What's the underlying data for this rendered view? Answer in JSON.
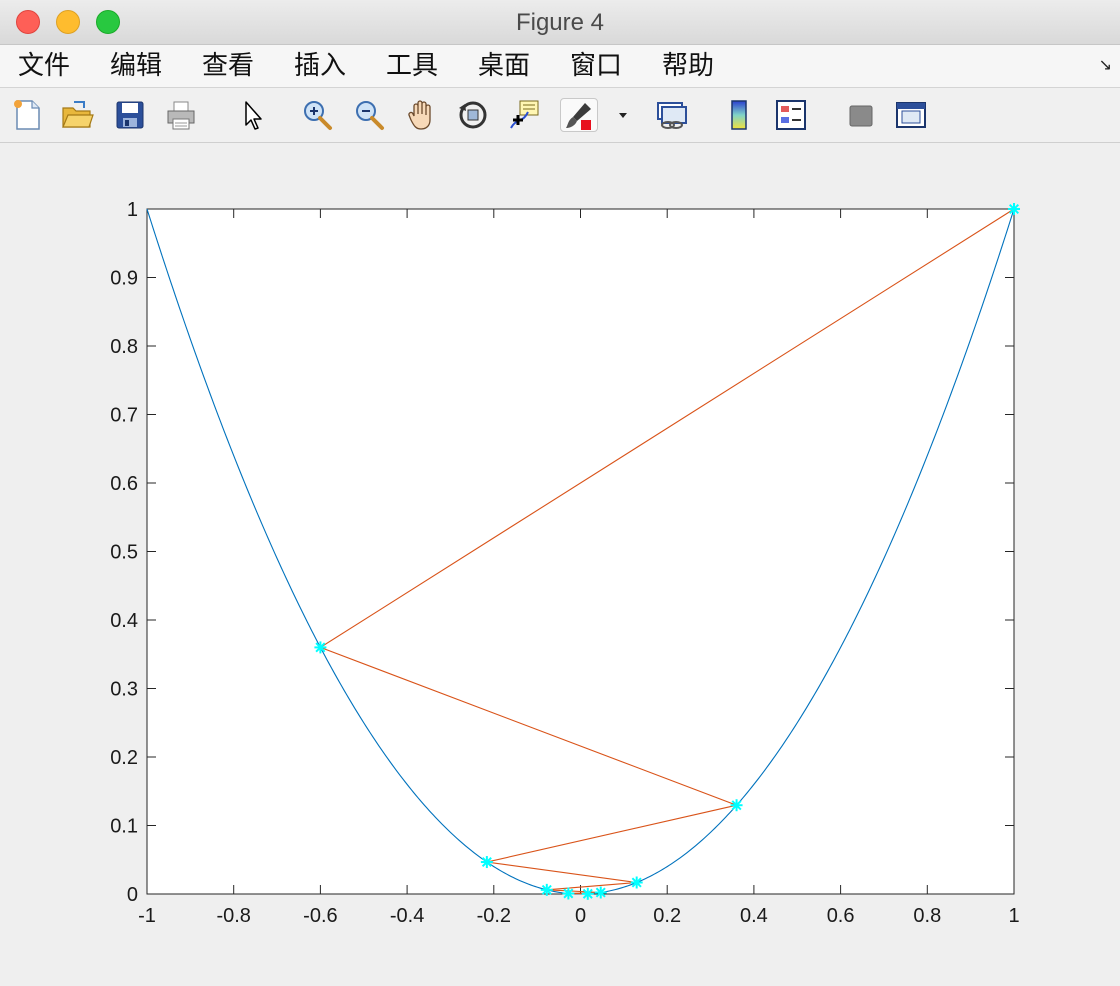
{
  "window": {
    "title": "Figure 4"
  },
  "menu": {
    "items": [
      "文件",
      "编辑",
      "查看",
      "插入",
      "工具",
      "桌面",
      "窗口",
      "帮助"
    ],
    "overflow_icon": "dock-arrow-icon"
  },
  "toolbar": {
    "buttons": [
      "new-figure-icon",
      "open-file-icon",
      "save-icon",
      "print-icon",
      "edit-plot-arrow-icon",
      "zoom-in-icon",
      "zoom-out-icon",
      "pan-hand-icon",
      "rotate-3d-icon",
      "data-cursor-icon",
      "brush-icon",
      "brush-dropdown-icon",
      "link-plot-icon",
      "colorbar-icon",
      "legend-icon",
      "hide-plot-tools-icon",
      "show-plot-tools-icon"
    ]
  },
  "chart_data": {
    "type": "line",
    "title": "",
    "xlabel": "",
    "ylabel": "",
    "xlim": [
      -1,
      1
    ],
    "ylim": [
      0,
      1
    ],
    "xticks": [
      "-1",
      "-0.8",
      "-0.6",
      "-0.4",
      "-0.2",
      "0",
      "0.2",
      "0.4",
      "0.6",
      "0.8",
      "1"
    ],
    "yticks": [
      "0",
      "0.1",
      "0.2",
      "0.3",
      "0.4",
      "0.5",
      "0.6",
      "0.7",
      "0.8",
      "0.9",
      "1"
    ],
    "grid": false,
    "series": [
      {
        "style": "curve",
        "color": "#0072bd",
        "function": "y = x^2",
        "x_range": [
          -1,
          1
        ]
      },
      {
        "style": "polyline",
        "color": "#d95319",
        "x": [
          1,
          -0.6,
          0.36,
          -0.216,
          0.1296,
          -0.07776,
          0.046656,
          -0.0279936,
          0.01679616
        ],
        "y": [
          1,
          0.36,
          0.1296,
          0.046656,
          0.01679616,
          0.0060466,
          0.0021768,
          0.00078364,
          0.00028211
        ]
      },
      {
        "style": "markers",
        "marker": "asterisk",
        "color": "#00ffff",
        "x": [
          1,
          -0.6,
          0.36,
          -0.216,
          0.1296,
          -0.07776,
          0.046656,
          -0.0279936,
          0.01679616
        ],
        "y": [
          1,
          0.36,
          0.1296,
          0.046656,
          0.01679616,
          0.0060466,
          0.0021768,
          0.00078364,
          0.00028211
        ]
      }
    ]
  }
}
